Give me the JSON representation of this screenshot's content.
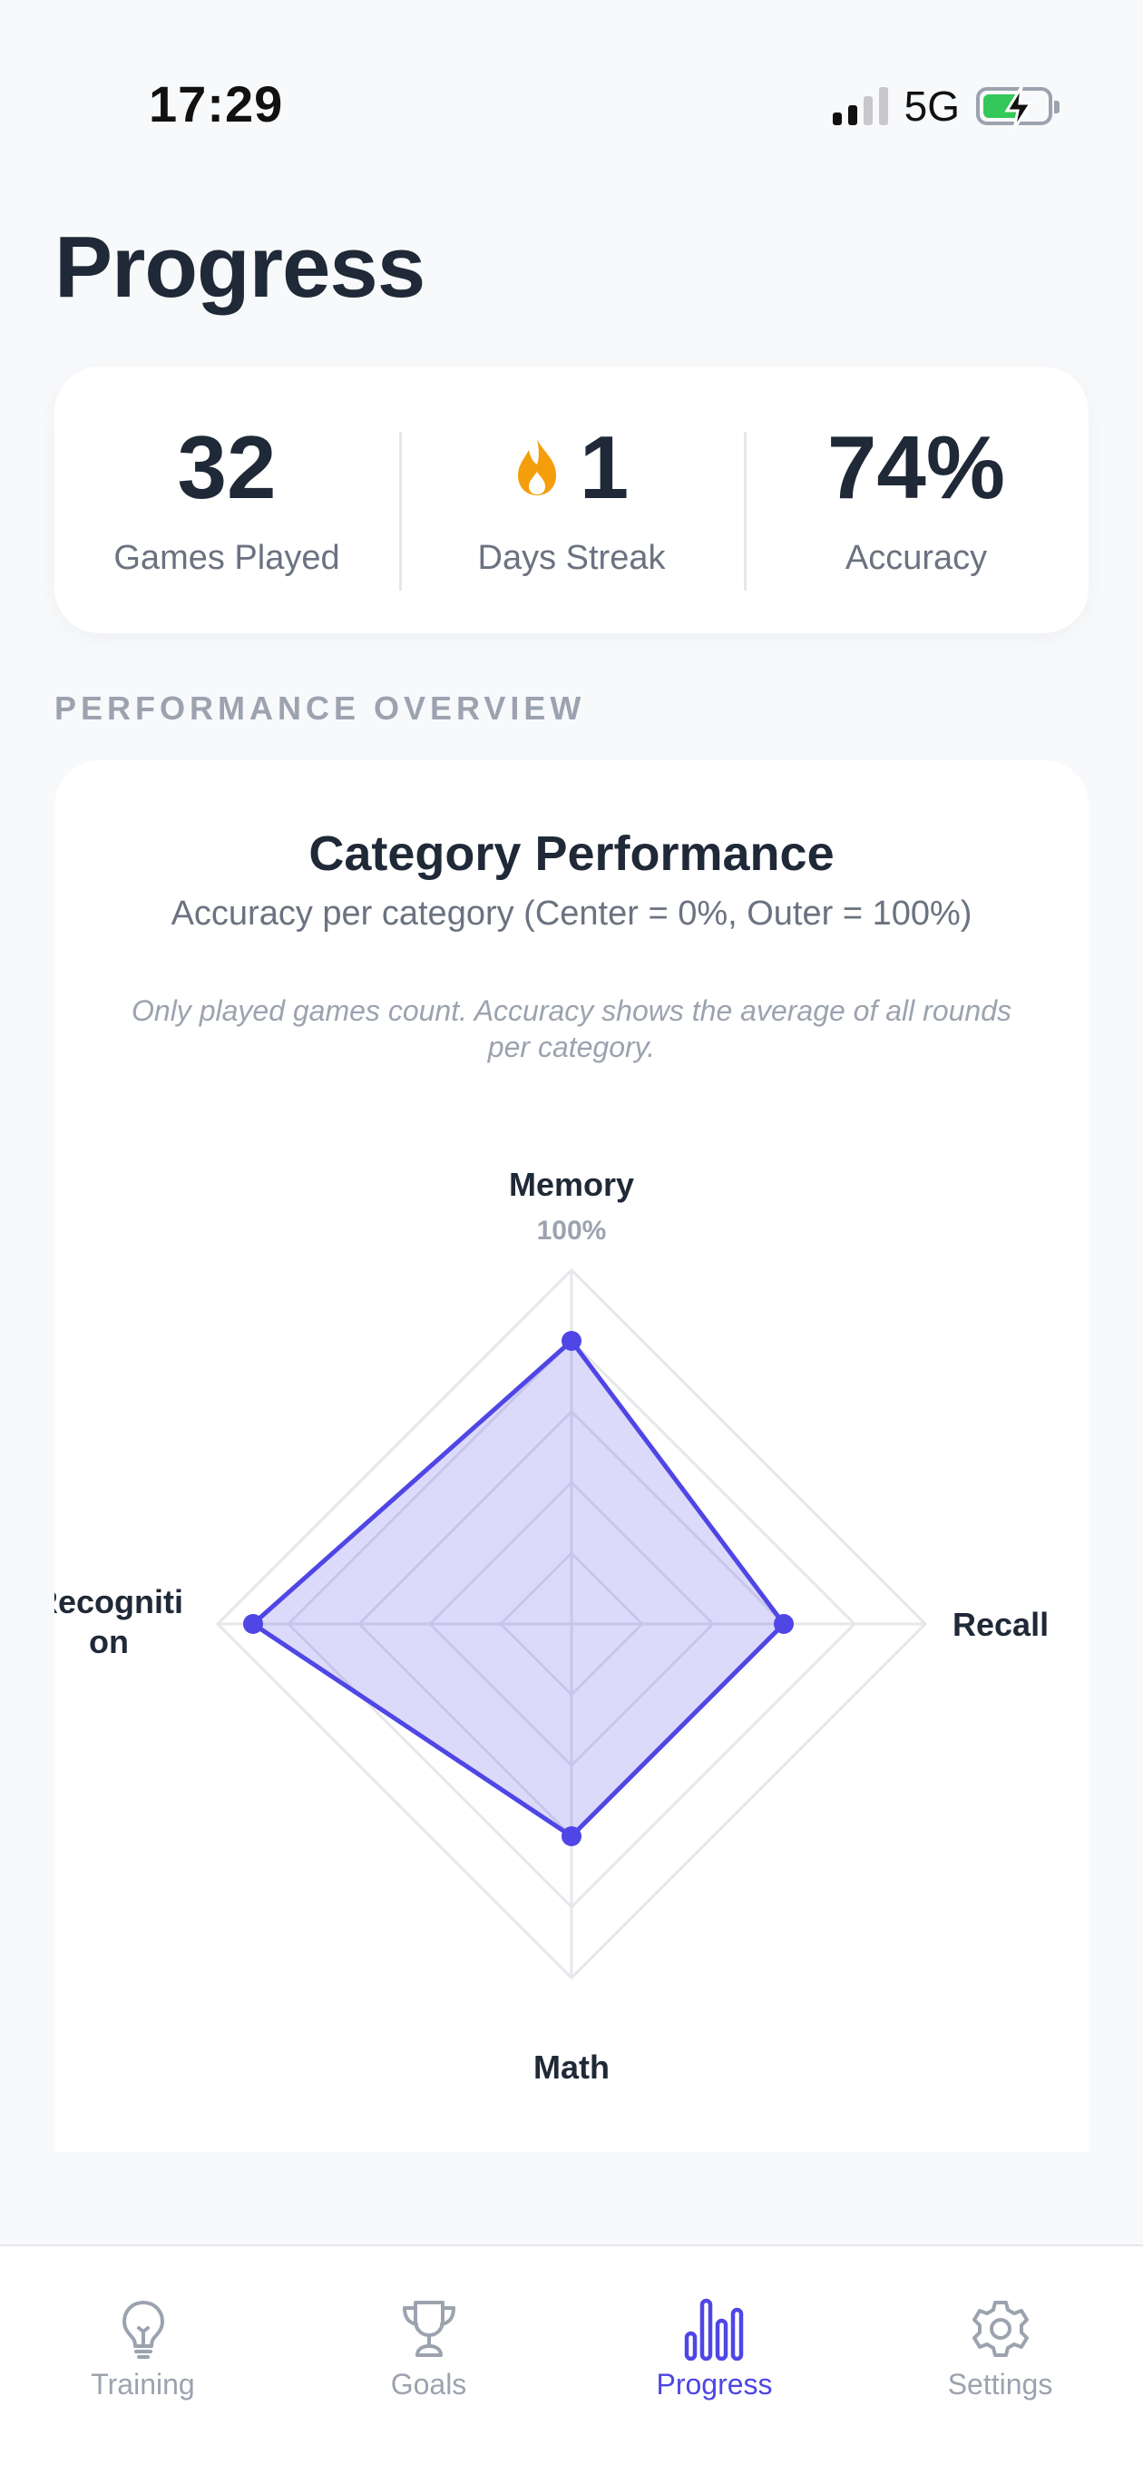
{
  "status": {
    "time": "17:29",
    "network": "5G"
  },
  "page": {
    "title": "Progress"
  },
  "stats": [
    {
      "value": "32",
      "label": "Games Played"
    },
    {
      "value": "1",
      "label": "Days Streak",
      "icon": "flame-icon"
    },
    {
      "value": "74%",
      "label": "Accuracy"
    }
  ],
  "section": {
    "label": "PERFORMANCE OVERVIEW"
  },
  "chart": {
    "title": "Category Performance",
    "subtitle": "Accuracy per category (Center = 0%, Outer = 100%)",
    "note": "Only played games count. Accuracy shows the average of all rounds per category.",
    "scale_label": "100%",
    "colors": {
      "line": "#4f46e5",
      "fill": "#4f46e5",
      "grid": "#e5e7eb"
    }
  },
  "chart_data": {
    "type": "radar",
    "title": "Category Performance",
    "categories": [
      "Memory",
      "Recall",
      "Math",
      "Recognition"
    ],
    "values": [
      80,
      60,
      60,
      90
    ],
    "range": [
      0,
      100
    ],
    "grid_levels": [
      20,
      40,
      60,
      80,
      100
    ]
  },
  "tabs": [
    {
      "label": "Training",
      "icon": "lightbulb-icon",
      "active": false
    },
    {
      "label": "Goals",
      "icon": "trophy-icon",
      "active": false
    },
    {
      "label": "Progress",
      "icon": "bar-chart-icon",
      "active": true
    },
    {
      "label": "Settings",
      "icon": "gear-icon",
      "active": false
    }
  ]
}
